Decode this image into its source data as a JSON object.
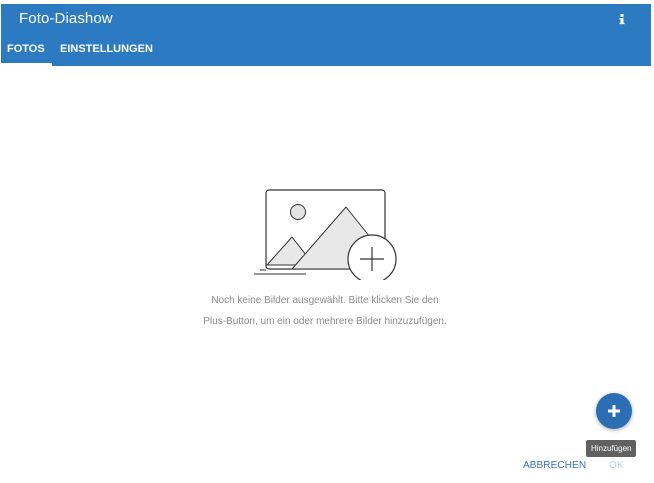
{
  "header": {
    "title": "Foto-Diashow",
    "info_icon": "info-icon",
    "background_color": "#2c7bc2"
  },
  "tabs": [
    {
      "label": "FOTOS",
      "active": true
    },
    {
      "label": "EINSTELLUNGEN",
      "active": false
    }
  ],
  "empty_state": {
    "illustration_icon": "add-photo-icon",
    "message": "Noch keine Bilder ausgewählt. Bitte klicken Sie den Plus-Button, um ein oder mehrere Bilder hinzuzufügen."
  },
  "fab": {
    "icon": "plus-icon",
    "tooltip": "Hinzufügen",
    "color": "#2c6eb3"
  },
  "actions": {
    "cancel_label": "ABBRECHEN",
    "ok_label": "OK"
  }
}
